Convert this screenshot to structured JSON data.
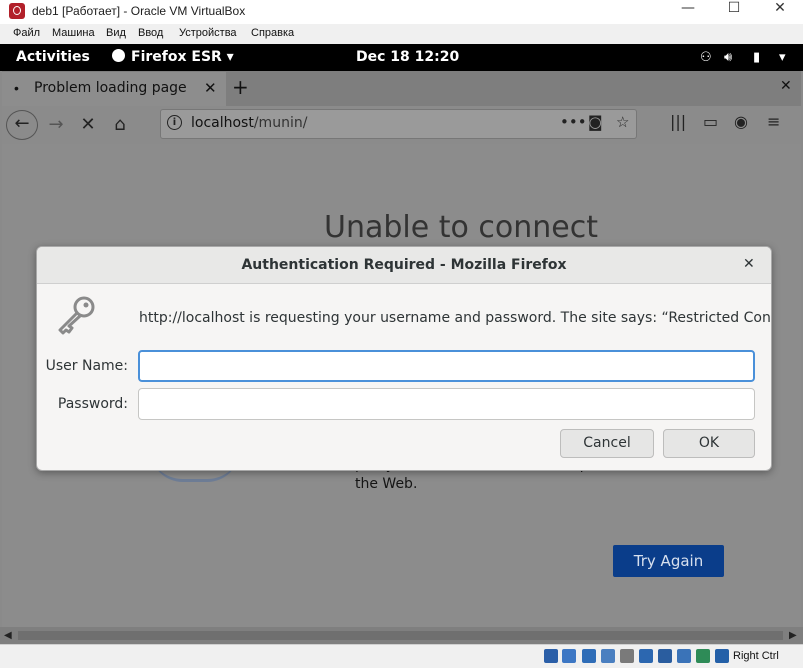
{
  "vbox": {
    "title": "deb1 [Работает] - Oracle VM VirtualBox",
    "menu": [
      "Файл",
      "Машина",
      "Вид",
      "Ввод",
      "Устройства",
      "Справка"
    ],
    "minimize": "—",
    "maximize": "☐",
    "close": "✕",
    "status_host_key": "Right Ctrl"
  },
  "gnome": {
    "activities": "Activities",
    "app_menu": "Firefox ESR",
    "clock": "Dec 18  12:20"
  },
  "firefox": {
    "tab_label": "Problem loading page",
    "url_host": "localhost",
    "url_path": "/munin/",
    "error_title": "Unable to connect",
    "error_body": "proxy, make sure that Firefox is permitted to access the Web.",
    "try_again": "Try Again"
  },
  "dialog": {
    "title": "Authentication Required - Mozilla Firefox",
    "message": "http://localhost is requesting your username and password. The site says: “Restricted Content”",
    "username_label": "User Name:",
    "password_label": "Password:",
    "username_value": "",
    "password_value": "",
    "cancel": "Cancel",
    "ok": "OK"
  },
  "colors": {
    "accent": "#4a90d9",
    "try_again_bg": "#0a3d8a",
    "vbox_icon": "#b2202a"
  }
}
